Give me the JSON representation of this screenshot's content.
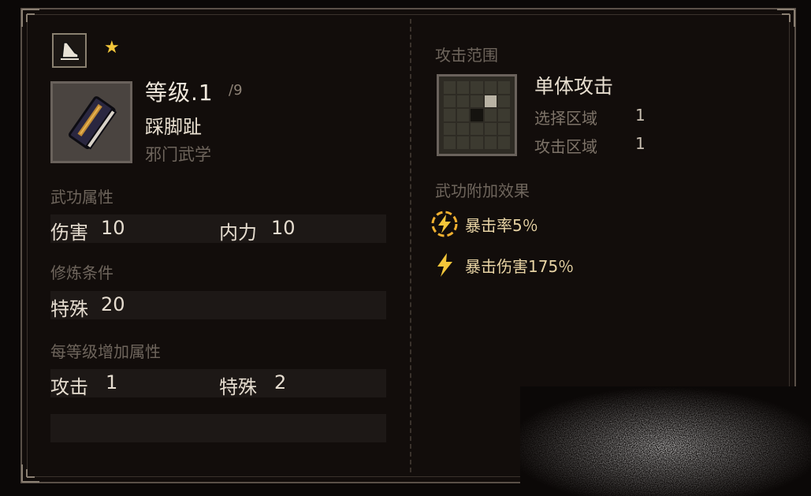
{
  "panel": {
    "type_icon": "boot-kick-icon",
    "star_icon": "star-icon",
    "book_icon": "skill-book-icon",
    "level_label": "等级.1",
    "level_max": "/9",
    "skill_name": "踩脚趾",
    "skill_category": "邪门武学"
  },
  "attributes": {
    "title": "武功属性",
    "damage_label": "伤害",
    "damage_value": "10",
    "inner_power_label": "内力",
    "inner_power_value": "10"
  },
  "requirements": {
    "title": "修炼条件",
    "special_label": "特殊",
    "special_value": "20"
  },
  "per_level": {
    "title": "每等级增加属性",
    "attack_label": "攻击",
    "attack_value": "1",
    "special_label": "特殊",
    "special_value": "2"
  },
  "range": {
    "title": "攻击范围",
    "attack_type": "单体攻击",
    "select_area_label": "选择区域",
    "select_area_value": "1",
    "attack_area_label": "攻击区域",
    "attack_area_value": "1"
  },
  "effects": {
    "title": "武功附加效果",
    "items": [
      {
        "icon": "lightning-circle-icon",
        "text": "暴击率5％"
      },
      {
        "icon": "lightning-icon",
        "text": "暴击伤害175％"
      }
    ]
  },
  "colors": {
    "background": "#0b0807",
    "accent_gold": "#f3c63a",
    "effect_text": "#e7d3a4"
  }
}
